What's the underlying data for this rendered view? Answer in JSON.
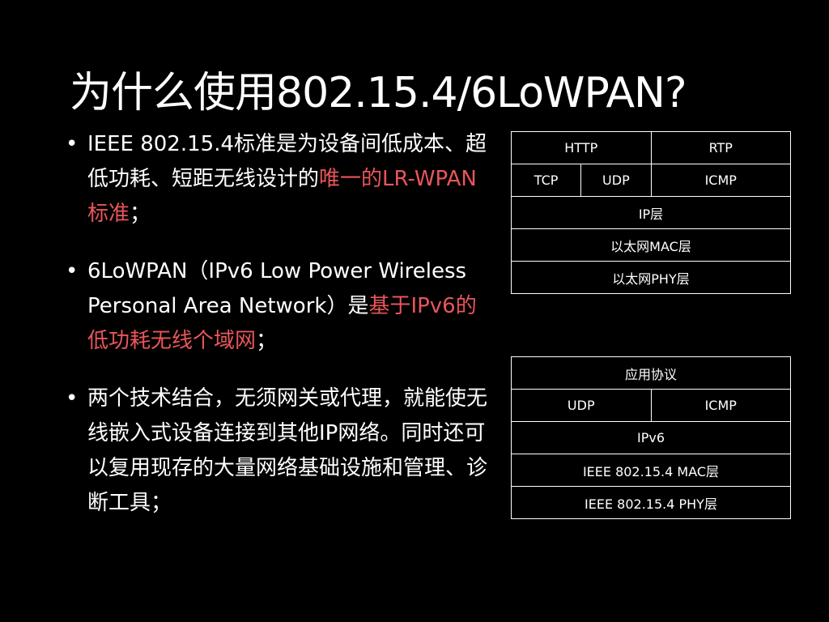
{
  "slide": {
    "title": "为什么使用802.15.4/6LoWPAN?"
  },
  "bullets": [
    {
      "marker": "•",
      "plain": "IEEE 802.15.4标准是为设备间低成本、超低功耗、短距无线设计的",
      "highlight": "唯一的LR-WPAN标准",
      "tail": "；"
    },
    {
      "marker": "•",
      "plain": "6LoWPAN（IPv6 Low Power Wireless Personal Area Network）是",
      "highlight": "基于IPv6的低功耗无线个域网",
      "tail": "；"
    },
    {
      "marker": "•",
      "plain": "两个技术结合，无须网关或代理，就能使无线嵌入式设备连接到其他IP网络。同时还可以复用现存的大量网络基础设施和管理、诊断工具；",
      "highlight": "",
      "tail": ""
    }
  ],
  "stack_ethernet": {
    "row1": [
      "HTTP",
      "RTP"
    ],
    "row2": [
      "TCP",
      "UDP",
      "ICMP"
    ],
    "row3": "IP层",
    "row4": "以太网MAC层",
    "row5": "以太网PHY层"
  },
  "stack_lowpan": {
    "row1": "应用协议",
    "row2": [
      "UDP",
      "ICMP"
    ],
    "row3": "IPv6",
    "row4": "IEEE 802.15.4 MAC层",
    "row5": "IEEE 802.15.4 PHY层"
  },
  "colors": {
    "background": "#000000",
    "text": "#ffffff",
    "highlight": "#e8565a",
    "table_border": "#ffffff"
  }
}
